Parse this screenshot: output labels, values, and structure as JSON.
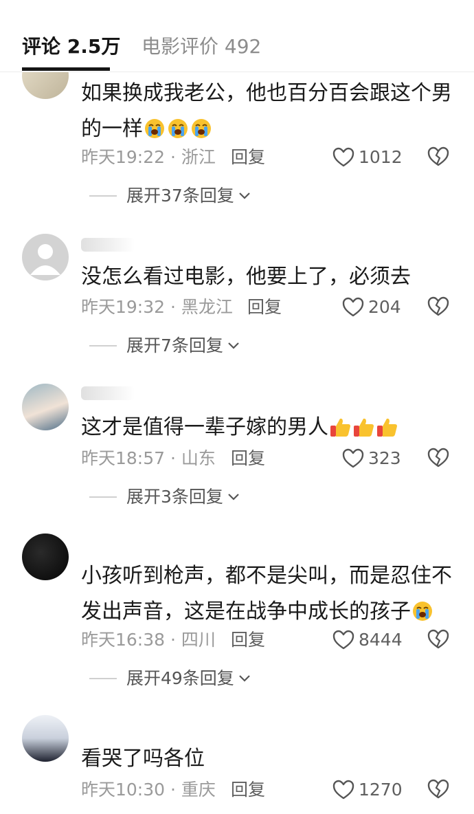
{
  "tabs": [
    {
      "label": "评论 2.5万",
      "active": true
    },
    {
      "label": "电影评价 492",
      "active": false
    }
  ],
  "comments": [
    {
      "text": "如果换成我老公，他也百分百会跟这个男的一样",
      "emojis": [
        "crying-face-emoji",
        "crying-face-emoji",
        "crying-face-emoji"
      ],
      "time": "昨天19:22 · 浙江",
      "reply": "回复",
      "likes": "1012",
      "expand": "展开37条回复"
    },
    {
      "text": "没怎么看过电影，他要上了，必须去",
      "time": "昨天19:32 · 黑龙江",
      "reply": "回复",
      "likes": "204",
      "expand": "展开7条回复"
    },
    {
      "text": "这才是值得一辈子嫁的男人",
      "emojis": [
        "thumbs-up-emoji",
        "thumbs-up-emoji",
        "thumbs-up-emoji"
      ],
      "time": "昨天18:57 · 山东",
      "reply": "回复",
      "likes": "323",
      "expand": "展开3条回复"
    },
    {
      "text": "小孩听到枪声，都不是尖叫，而是忍住不发出声音，这是在战争中成长的孩子",
      "emojis": [
        "crying-face-emoji"
      ],
      "time": "昨天16:38 · 四川",
      "reply": "回复",
      "likes": "8444",
      "expand": "展开49条回复"
    },
    {
      "text": "看哭了吗各位",
      "time": "昨天10:30 · 重庆",
      "reply": "回复",
      "likes": "1270"
    }
  ],
  "colors": {
    "accent": "#161616",
    "meta": "#9a9a9a",
    "emoji_yellow": "#f9c22e",
    "emoji_tear": "#4aa3ef",
    "thumb_cuff": "#e8453c"
  }
}
